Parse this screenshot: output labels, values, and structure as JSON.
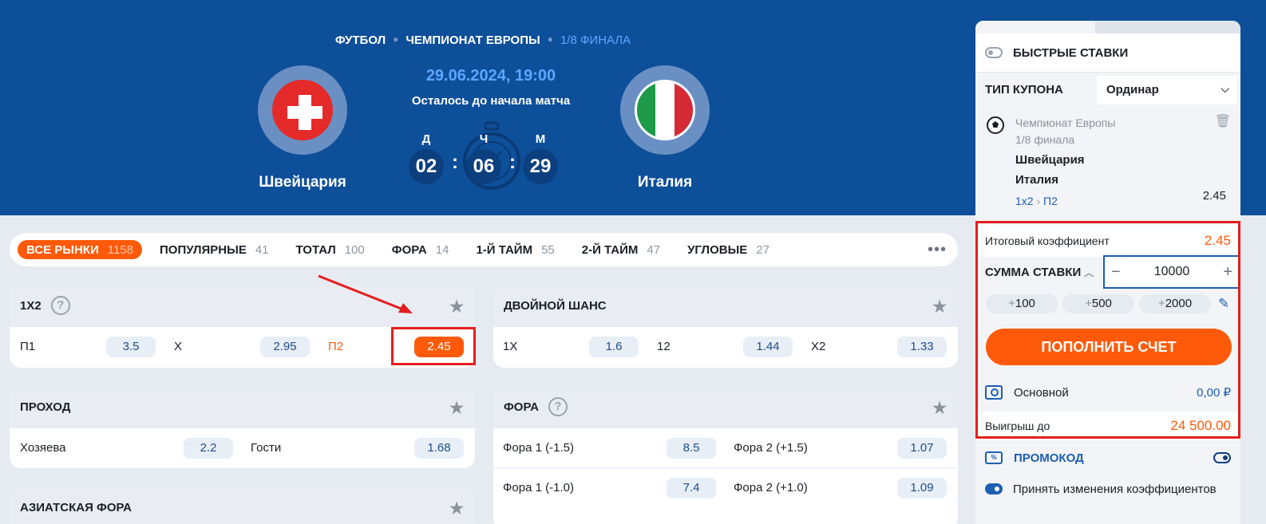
{
  "breadcrumb": {
    "sport": "ФУТБОЛ",
    "tournament": "ЧЕМПИОНАТ ЕВРОПЫ",
    "stage": "1/8 ФИНАЛА"
  },
  "match": {
    "home": "Швейцария",
    "away": "Италия",
    "datetime": "29.06.2024, 19:00",
    "countdown_label": "Осталось до начала матча",
    "countdown": {
      "days_label": "Д",
      "days": "02",
      "hours_label": "Ч",
      "hours": "06",
      "minutes_label": "М",
      "minutes": "29"
    }
  },
  "tabs": [
    {
      "label": "ВСЕ РЫНКИ",
      "count": "1158",
      "active": true
    },
    {
      "label": "ПОПУЛЯРНЫЕ",
      "count": "41"
    },
    {
      "label": "ТОТАЛ",
      "count": "100"
    },
    {
      "label": "ФОРА",
      "count": "14"
    },
    {
      "label": "1-Й ТАЙМ",
      "count": "55"
    },
    {
      "label": "2-Й ТАЙМ",
      "count": "47"
    },
    {
      "label": "УГЛОВЫЕ",
      "count": "27"
    }
  ],
  "markets": {
    "x12": {
      "title": "1Х2",
      "help": "?",
      "p1": "П1",
      "p1_odd": "3.5",
      "x": "Х",
      "x_odd": "2.95",
      "p2": "П2",
      "p2_odd": "2.45"
    },
    "double": {
      "title": "ДВОЙНОЙ ШАНС",
      "o1": "1Х",
      "o1_odd": "1.6",
      "o2": "12",
      "o2_odd": "1.44",
      "o3": "Х2",
      "o3_odd": "1.33"
    },
    "pass": {
      "title": "ПРОХОД",
      "home": "Хозяева",
      "home_odd": "2.2",
      "away": "Гости",
      "away_odd": "1.68"
    },
    "handicap": {
      "title": "ФОРА",
      "help": "?",
      "rows": [
        {
          "a": "Фора 1 (-1.5)",
          "a_odd": "8.5",
          "b": "Фора 2 (+1.5)",
          "b_odd": "1.07"
        },
        {
          "a": "Фора 1 (-1.0)",
          "a_odd": "7.4",
          "b": "Фора 2 (+1.0)",
          "b_odd": "1.09"
        }
      ]
    },
    "asian": {
      "title": "АЗИАТСКАЯ ФОРА"
    }
  },
  "coupon": {
    "fast_bets": "БЫСТРЫЕ СТАВКИ",
    "type_label": "ТИП КУПОНА",
    "type_value": "Ординар",
    "bet": {
      "tournament": "Чемпионат Европы",
      "stage": "1/8 финала",
      "home": "Швейцария",
      "away": "Италия",
      "market": "1х2",
      "outcome": "П2",
      "odd": "2.45"
    },
    "total_label": "Итоговый коэффициент",
    "total_value": "2.45",
    "sum_label": "СУММА СТАВКИ",
    "sum_value": "10000",
    "quick": [
      "100",
      "500",
      "2000"
    ],
    "topup": "ПОПОЛНИТЬ СЧЕТ",
    "account": "Основной",
    "balance": "0,00 ₽",
    "win_label": "Выигрыш до",
    "win_value": "24 500.00",
    "promo": "ПРОМОКОД",
    "accept": "Принять изменения коэффициентов"
  },
  "colors": {
    "header_bg": "#0e4f9a",
    "accent": "#ff5a0a",
    "link": "#1d5fb1",
    "highlight": "#e41e1e"
  }
}
